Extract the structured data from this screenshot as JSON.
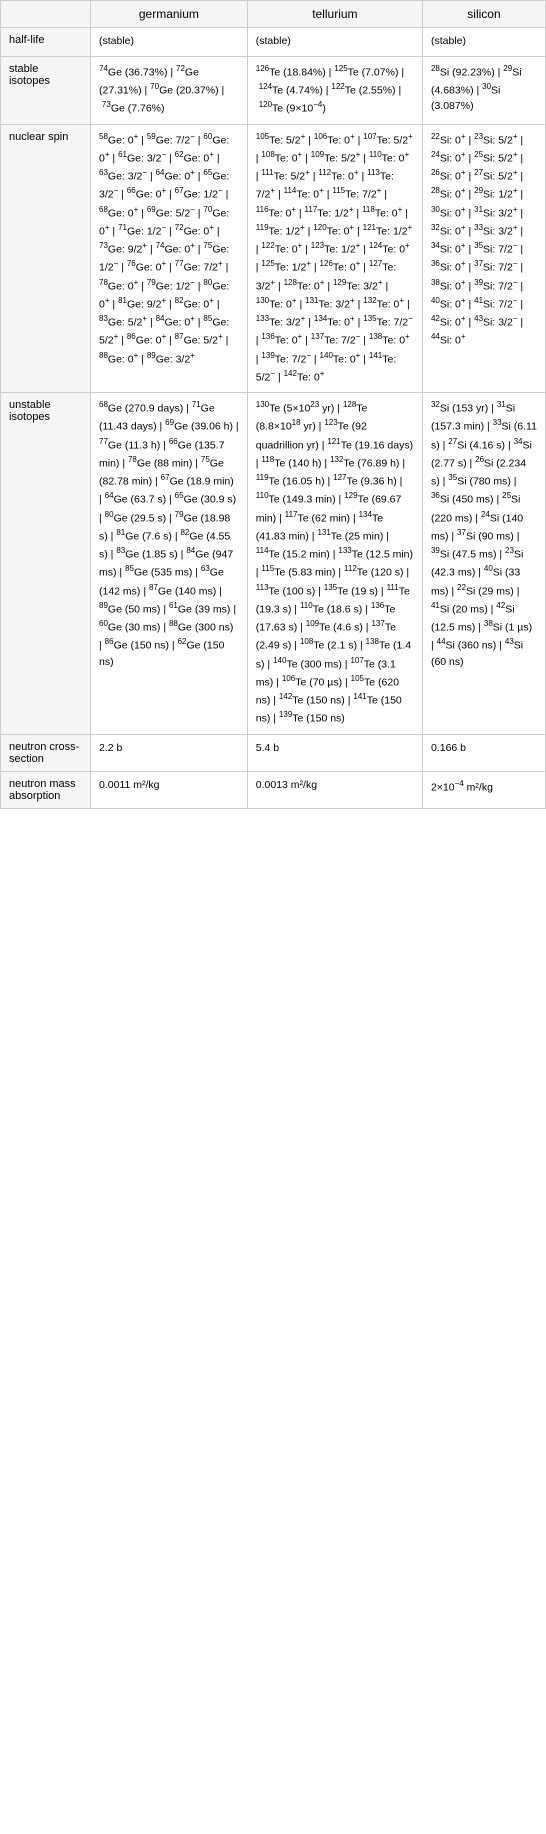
{
  "columns": {
    "col1": "germanium",
    "col2": "tellurium",
    "col3": "silicon"
  },
  "rows": {
    "half_life": {
      "label": "half-life",
      "ge": "(stable)",
      "te": "(stable)",
      "si": "(stable)"
    },
    "stable_isotopes": {
      "label": "stable isotopes",
      "ge": "74Ge (36.73%) | 72Ge (27.31%) | 70Ge (20.37%) | 73Ge (7.76%)",
      "te": "126Te (18.84%) | 125Te (7.07%) | 124Te (4.74%) | 122Te (2.55%) | 120Te (9×10⁻⁴)",
      "si": "28Si (92.23%) | 29Si (4.683%) | 30Si (3.087%)"
    },
    "nuclear_spin": {
      "label": "nuclear spin"
    },
    "unstable_isotopes": {
      "label": "unstable isotopes"
    },
    "neutron_cross": {
      "label": "neutron cross-section",
      "ge": "2.2 b",
      "te": "5.4 b",
      "si": "0.166 b"
    },
    "neutron_mass": {
      "label": "neutron mass absorption",
      "ge": "0.0011 m²/kg",
      "te": "0.0013 m²/kg",
      "si": "2×10⁻⁴ m²/kg"
    }
  }
}
